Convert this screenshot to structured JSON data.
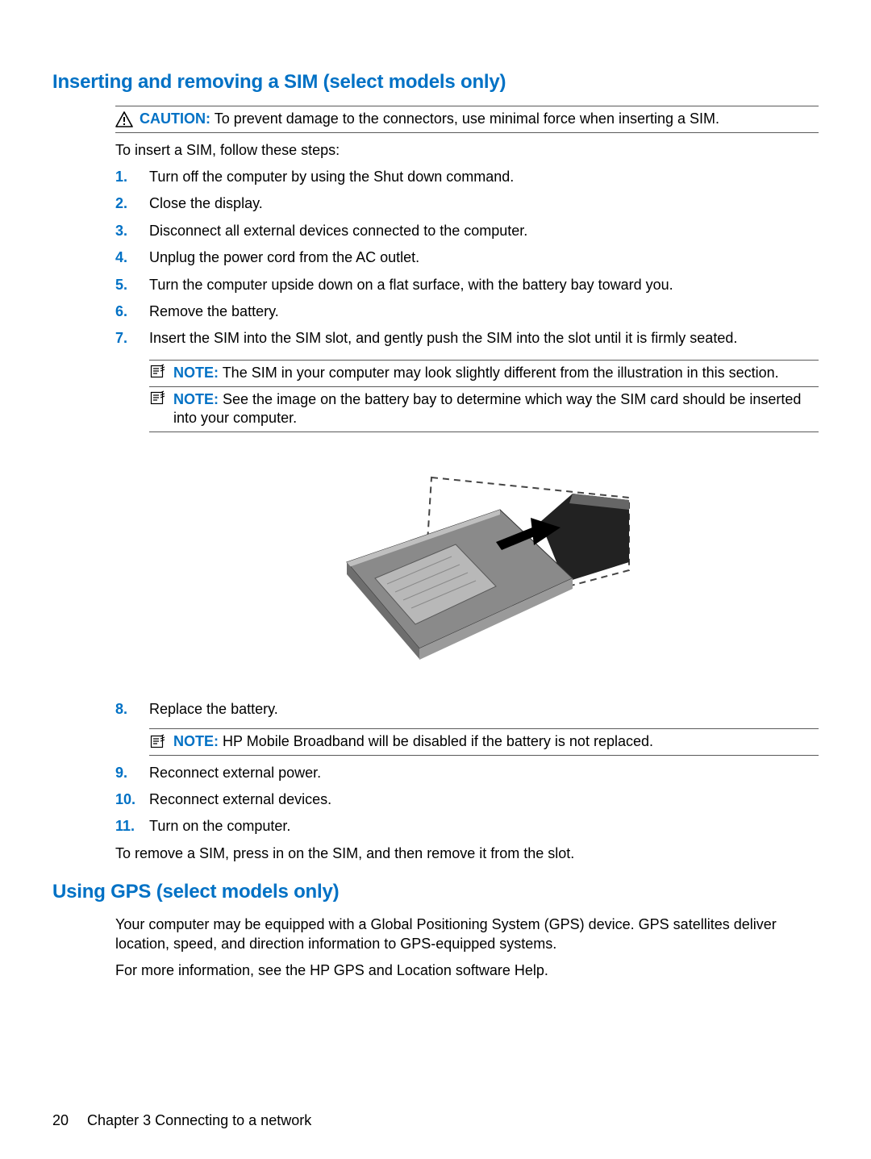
{
  "section1_title": "Inserting and removing a SIM (select models only)",
  "caution_label": "CAUTION:",
  "caution_body": "To prevent damage to the connectors, use minimal force when inserting a SIM.",
  "intro": "To insert a SIM, follow these steps:",
  "steps": {
    "s1": {
      "n": "1.",
      "t": "Turn off the computer by using the Shut down command."
    },
    "s2": {
      "n": "2.",
      "t": "Close the display."
    },
    "s3": {
      "n": "3.",
      "t": "Disconnect all external devices connected to the computer."
    },
    "s4": {
      "n": "4.",
      "t": "Unplug the power cord from the AC outlet."
    },
    "s5": {
      "n": "5.",
      "t": "Turn the computer upside down on a flat surface, with the battery bay toward you."
    },
    "s6": {
      "n": "6.",
      "t": "Remove the battery."
    },
    "s7": {
      "n": "7.",
      "t": "Insert the SIM into the SIM slot, and gently push the SIM into the slot until it is firmly seated."
    },
    "s8": {
      "n": "8.",
      "t": "Replace the battery."
    },
    "s9": {
      "n": "9.",
      "t": "Reconnect external power."
    },
    "s10": {
      "n": "10.",
      "t": "Reconnect external devices."
    },
    "s11": {
      "n": "11.",
      "t": "Turn on the computer."
    }
  },
  "note_label": "NOTE:",
  "note7a_body": "The SIM in your computer may look slightly different from the illustration in this section.",
  "note7b_body": "See the image on the battery bay to determine which way the SIM card should be inserted into your computer.",
  "note8_body": "HP Mobile Broadband will be disabled if the battery is not replaced.",
  "remove_para": "To remove a SIM, press in on the SIM, and then remove it from the slot.",
  "section2_title": "Using GPS (select models only)",
  "gps_para1": "Your computer may be equipped with a Global Positioning System (GPS) device. GPS satellites deliver location, speed, and direction information to GPS-equipped systems.",
  "gps_para2": "For more information, see the HP GPS and Location software Help.",
  "footer_page": "20",
  "footer_text": "Chapter 3   Connecting to a network"
}
